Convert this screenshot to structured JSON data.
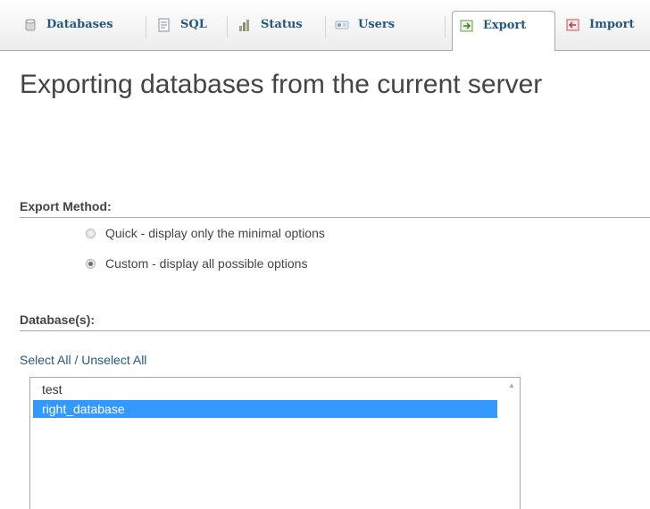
{
  "tabs": [
    {
      "label": "Databases",
      "icon": "database-icon",
      "active": false
    },
    {
      "label": "SQL",
      "icon": "sql-icon",
      "active": false
    },
    {
      "label": "Status",
      "icon": "status-icon",
      "active": false
    },
    {
      "label": "Users",
      "icon": "users-icon",
      "active": false
    },
    {
      "label": "Export",
      "icon": "export-icon",
      "active": true
    },
    {
      "label": "Import",
      "icon": "import-icon",
      "active": false
    }
  ],
  "page": {
    "title": "Exporting databases from the current server"
  },
  "export_method": {
    "heading": "Export Method:",
    "options": [
      {
        "label": "Quick - display only the minimal options",
        "checked": false
      },
      {
        "label": "Custom - display all possible options",
        "checked": true
      }
    ]
  },
  "databases": {
    "heading": "Database(s):",
    "select_all": "Select All",
    "divider": " / ",
    "unselect_all": "Unselect All",
    "items": [
      {
        "name": "test",
        "selected": false
      },
      {
        "name": "right_database",
        "selected": true
      }
    ]
  },
  "colors": {
    "link": "#235a81",
    "selection": "#3399ff"
  }
}
